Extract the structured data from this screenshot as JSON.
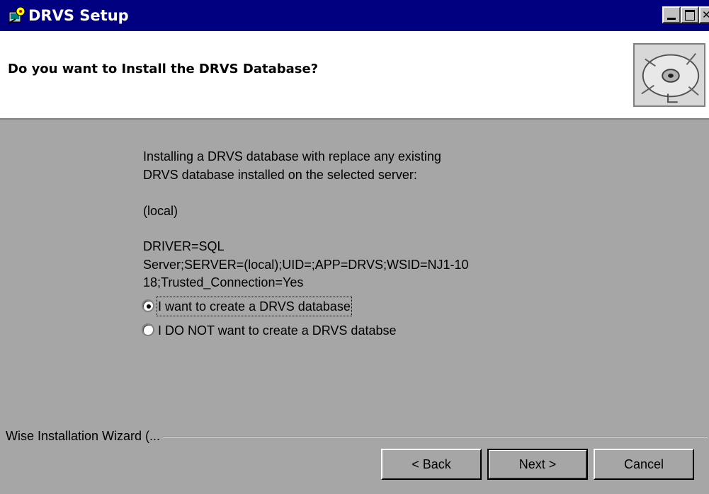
{
  "window": {
    "title": "DRVS Setup"
  },
  "header": {
    "title": "Do you want to Install the DRVS Database?"
  },
  "content": {
    "lines": [
      "Installing a DRVS database with replace any existing",
      "DRVS database installed on the selected server:",
      "(local)",
      "DRIVER=SQL",
      "Server;SERVER=(local);UID=;APP=DRVS;WSID=NJ1-10",
      "18;Trusted_Connection=Yes"
    ],
    "options": [
      {
        "label": "I want to create a DRVS database",
        "selected": true
      },
      {
        "label": "I DO NOT want to create a DRVS databse",
        "selected": false
      }
    ]
  },
  "footer": {
    "group_label": "Wise Installation Wizard (...",
    "back_label": "< Back",
    "next_label": "Next >",
    "cancel_label": "Cancel"
  },
  "icons": {
    "app": "setup-app-icon",
    "header": "cd-disc-icon"
  }
}
